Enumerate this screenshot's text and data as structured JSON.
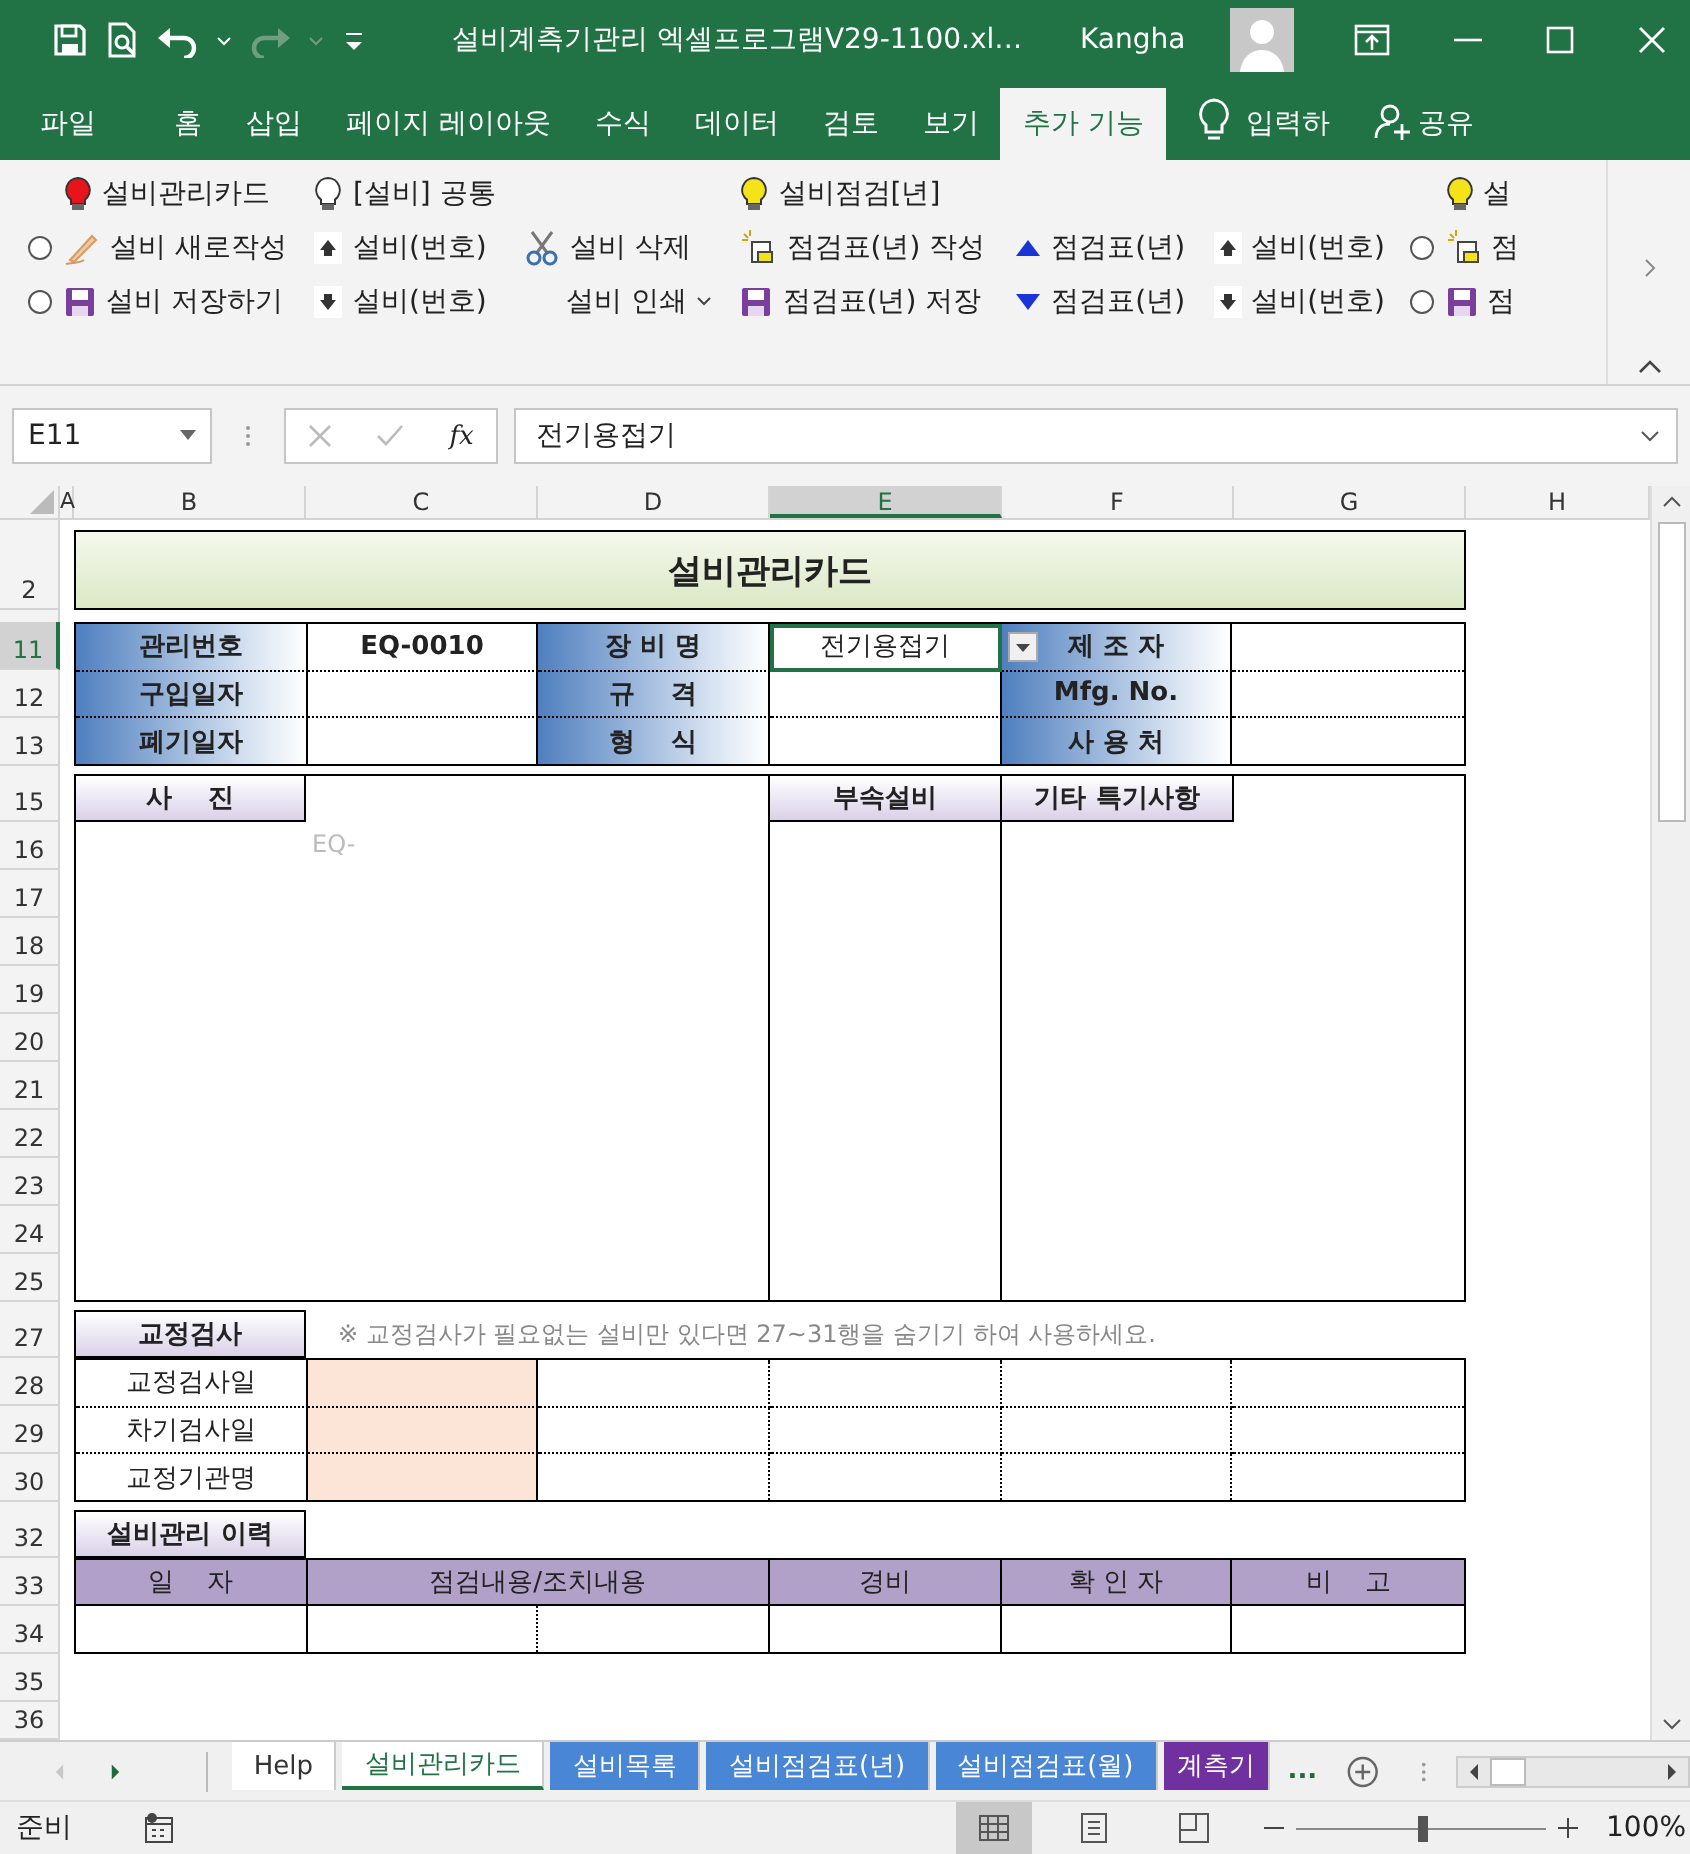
{
  "window": {
    "title": "설비계측기관리 엑셀프로그램V29-1100.xl…",
    "user": "Kangha"
  },
  "ribbon_tabs": [
    {
      "label": "파일",
      "selected": false
    },
    {
      "label": "홈",
      "selected": false
    },
    {
      "label": "삽입",
      "selected": false
    },
    {
      "label": "페이지 레이아웃",
      "selected": false
    },
    {
      "label": "수식",
      "selected": false
    },
    {
      "label": "데이터",
      "selected": false
    },
    {
      "label": "검토",
      "selected": false
    },
    {
      "label": "보기",
      "selected": false
    },
    {
      "label": "추가 기능",
      "selected": true
    }
  ],
  "tell_me": "입력하",
  "share": "공유",
  "ribbon": {
    "groups": [
      {
        "items": [
          {
            "kind": "bulb-red",
            "label": "설비관리카드"
          },
          {
            "kind": "pencil",
            "label": "설비 새로작성",
            "radio_selected": false
          },
          {
            "kind": "save",
            "label": "설비 저장하기",
            "radio_selected": false
          }
        ]
      },
      {
        "items": [
          {
            "kind": "bulb",
            "label": "[설비] 공통"
          },
          {
            "kind": "up",
            "label": "설비(번호)"
          },
          {
            "kind": "down",
            "label": "설비(번호)"
          }
        ]
      },
      {
        "items": [
          {
            "kind": "scissors",
            "label": "설비 삭제"
          },
          {
            "kind": "menu",
            "label": "설비 인쇄"
          }
        ]
      },
      {
        "items": [
          {
            "kind": "bulb-yellow",
            "label": "설비점검[년]"
          },
          {
            "kind": "new",
            "label": "점검표(년) 작성"
          },
          {
            "kind": "save",
            "label": "점검표(년) 저장"
          }
        ]
      },
      {
        "items": [
          {
            "kind": "tri-up",
            "label": "점검표(년)"
          },
          {
            "kind": "tri-down",
            "label": "점검표(년)"
          }
        ]
      },
      {
        "items": [
          {
            "kind": "up",
            "label": "설비(번호)"
          },
          {
            "kind": "down",
            "label": "설비(번호)"
          }
        ]
      },
      {
        "items": [
          {
            "kind": "bulb-yellow",
            "label": "설"
          },
          {
            "kind": "new",
            "label": "점",
            "radio_selected": false
          },
          {
            "kind": "save",
            "label": "점",
            "radio_selected": false
          }
        ]
      }
    ]
  },
  "formula_bar": {
    "name_box": "E11",
    "fx": "fx",
    "formula": "전기용접기"
  },
  "sheet": {
    "columns": [
      {
        "label": "A",
        "selected": false
      },
      {
        "label": "B",
        "selected": false
      },
      {
        "label": "C",
        "selected": false
      },
      {
        "label": "D",
        "selected": false
      },
      {
        "label": "E",
        "selected": true
      },
      {
        "label": "F",
        "selected": false
      },
      {
        "label": "G",
        "selected": false
      },
      {
        "label": "H",
        "selected": false
      }
    ],
    "rows": [
      {
        "label": "2",
        "selected": false
      },
      {
        "label": "11",
        "selected": true
      },
      {
        "label": "12",
        "selected": false
      },
      {
        "label": "13",
        "selected": false
      },
      {
        "label": "15",
        "selected": false
      },
      {
        "label": "16",
        "selected": false
      },
      {
        "label": "17",
        "selected": false
      },
      {
        "label": "18",
        "selected": false
      },
      {
        "label": "19",
        "selected": false
      },
      {
        "label": "20",
        "selected": false
      },
      {
        "label": "21",
        "selected": false
      },
      {
        "label": "22",
        "selected": false
      },
      {
        "label": "23",
        "selected": false
      },
      {
        "label": "24",
        "selected": false
      },
      {
        "label": "25",
        "selected": false
      },
      {
        "label": "27",
        "selected": false
      },
      {
        "label": "28",
        "selected": false
      },
      {
        "label": "29",
        "selected": false
      },
      {
        "label": "30",
        "selected": false
      },
      {
        "label": "32",
        "selected": false
      },
      {
        "label": "33",
        "selected": false
      },
      {
        "label": "34",
        "selected": false
      },
      {
        "label": "35",
        "selected": false
      },
      {
        "label": "36",
        "selected": false
      }
    ],
    "title": "설비관리카드",
    "info": [
      [
        {
          "kind": "label",
          "text": "관리번호",
          "selected": false
        },
        {
          "kind": "value",
          "text": "EQ-0010",
          "selected": false
        },
        {
          "kind": "label",
          "text": "장 비 명",
          "selected": false
        },
        {
          "kind": "value",
          "text": "전기용접기",
          "selected": true
        },
        {
          "kind": "label",
          "text": "제 조 자",
          "selected": false
        },
        {
          "kind": "value",
          "selected": false
        }
      ],
      [
        {
          "kind": "label",
          "text": "구입일자",
          "selected": false
        },
        {
          "kind": "value",
          "selected": false
        },
        {
          "kind": "label",
          "text": "규    격",
          "selected": false
        },
        {
          "kind": "value",
          "selected": false
        },
        {
          "kind": "label",
          "text": "Mfg. No.",
          "selected": false
        },
        {
          "kind": "value",
          "selected": false
        }
      ],
      [
        {
          "kind": "label",
          "text": "폐기일자",
          "selected": false
        },
        {
          "kind": "value",
          "selected": false
        },
        {
          "kind": "label",
          "text": "형    식",
          "selected": false
        },
        {
          "kind": "value",
          "selected": false
        },
        {
          "kind": "label",
          "text": "사 용 처",
          "selected": false
        },
        {
          "kind": "value",
          "selected": false
        }
      ]
    ],
    "photo": {
      "header": "사    진",
      "placeholder": "EQ-",
      "accessory_header": "부속설비",
      "notes_header": "기타 특기사항"
    },
    "calibration": {
      "title": "교정검사",
      "note": "※ 교정검사가 필요없는 설비만 있다면 27~31행을 숨기기 하여 사용하세요.",
      "rows": [
        "교정검사일",
        "차기검사일",
        "교정기관명"
      ]
    },
    "history": {
      "title": "설비관리 이력",
      "columns": [
        "일    자",
        "점검내용/조치내용",
        "경비",
        "확 인 자",
        "비    고"
      ]
    }
  },
  "sheet_tabs": [
    {
      "label": "Help",
      "selected": false
    },
    {
      "label": "설비관리카드",
      "selected": true
    },
    {
      "label": "설비목록",
      "selected": false,
      "color": "#4a86d6"
    },
    {
      "label": "설비점검표(년)",
      "selected": false,
      "color": "#4a86d6"
    },
    {
      "label": "설비점검표(월)",
      "selected": false,
      "color": "#4a86d6"
    },
    {
      "label": "계측기",
      "selected": false,
      "color": "#7030a0"
    }
  ],
  "more_tabs": "...",
  "status": {
    "text": "준비",
    "views": [
      {
        "kind": "normal",
        "selected": true
      },
      {
        "kind": "page-layout",
        "selected": false
      },
      {
        "kind": "page-break",
        "selected": false
      }
    ],
    "zoom": {
      "level": 0.5,
      "reading": "100%"
    }
  }
}
